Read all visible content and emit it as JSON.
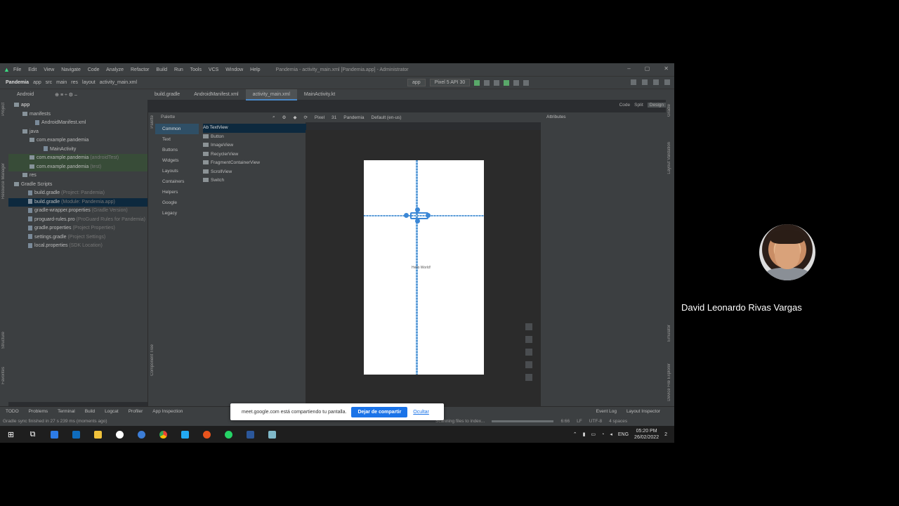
{
  "ide": {
    "menu": [
      "File",
      "Edit",
      "View",
      "Navigate",
      "Code",
      "Analyze",
      "Refactor",
      "Build",
      "Run",
      "Tools",
      "VCS",
      "Window",
      "Help"
    ],
    "window_title": "Pandemia - activity_main.xml [Pandemia.app] - Administrator",
    "breadcrumb": [
      "Pandemia",
      "app",
      "src",
      "main",
      "res",
      "layout",
      "activity_main.xml"
    ],
    "run_config": "app",
    "device": "Pixel 5 API 30",
    "project_view": "Android",
    "tabs": [
      "build.gradle",
      "AndroidManifest.xml",
      "activity_main.xml",
      "MainActivity.kt"
    ],
    "active_tab": "activity_main.xml",
    "view_modes": [
      "Code",
      "Split",
      "Design"
    ]
  },
  "tree": [
    {
      "label": "app",
      "note": ""
    },
    {
      "label": "manifests",
      "note": ""
    },
    {
      "label": "AndroidManifest.xml",
      "note": ""
    },
    {
      "label": "java",
      "note": ""
    },
    {
      "label": "com.example.pandemia",
      "note": ""
    },
    {
      "label": "MainActivity",
      "note": ""
    },
    {
      "label": "com.example.pandemia",
      "note": "(androidTest)"
    },
    {
      "label": "com.example.pandemia",
      "note": "(test)"
    },
    {
      "label": "res",
      "note": ""
    },
    {
      "label": "Gradle Scripts",
      "note": ""
    },
    {
      "label": "build.gradle",
      "note": "(Project: Pandemia)"
    },
    {
      "label": "build.gradle",
      "note": "(Module: Pandemia.app)"
    },
    {
      "label": "gradle-wrapper.properties",
      "note": "(Gradle Version)"
    },
    {
      "label": "proguard-rules.pro",
      "note": "(ProGuard Rules for Pandemia)"
    },
    {
      "label": "gradle.properties",
      "note": "(Project Properties)"
    },
    {
      "label": "settings.gradle",
      "note": "(Project Settings)"
    },
    {
      "label": "local.properties",
      "note": "(SDK Location)"
    }
  ],
  "palette": {
    "title": "Palette",
    "categories": [
      "Common",
      "Text",
      "Buttons",
      "Widgets",
      "Layouts",
      "Containers",
      "Helpers",
      "Google",
      "Legacy"
    ],
    "items": [
      "Ab TextView",
      "Button",
      "ImageView",
      "RecyclerView",
      "FragmentContainerView",
      "ScrollView",
      "Switch"
    ]
  },
  "design_toolbar": {
    "device": "Pixel",
    "api": "31",
    "theme": "Pandemia",
    "locale": "Default (en-us)",
    "attributes": "Attributes"
  },
  "preview": {
    "text": "Hello World!"
  },
  "bottom_tools": [
    "TODO",
    "Problems",
    "Terminal",
    "Build",
    "Logcat",
    "Profiler",
    "App Inspection"
  ],
  "bottom_tools_right": [
    "Event Log",
    "Layout Inspector"
  ],
  "status": {
    "left": "Gradle sync finished in 27 s 239 ms (moments ago)",
    "task": "Scanning files to index...",
    "pos": "6:66",
    "lf": "LF",
    "enc": "UTF-8",
    "indent": "4 spaces"
  },
  "meet_banner": {
    "message": "meet.google.com está compartiendo tu pantalla.",
    "stop_label": "Dejar de compartir",
    "hide_label": "Ocultar"
  },
  "taskbar": {
    "lang": "ENG",
    "time": "05:20 PM",
    "date": "26/02/2022",
    "notif": "2"
  },
  "participant": {
    "name": "David Leonardo Rivas Vargas"
  }
}
